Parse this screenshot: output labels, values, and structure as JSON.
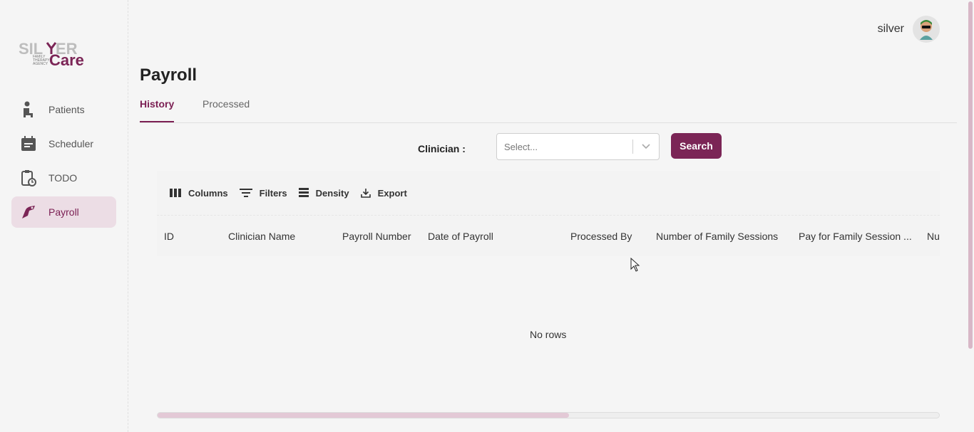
{
  "brand": {
    "logo_top": "SILVER",
    "logo_sub": "FAMILY THERAPY AGENCY",
    "logo_main": "Care"
  },
  "sidebar": {
    "items": [
      {
        "label": "Patients",
        "icon": "patient-icon"
      },
      {
        "label": "Scheduler",
        "icon": "calendar-icon"
      },
      {
        "label": "TODO",
        "icon": "clipboard-clock-icon"
      },
      {
        "label": "Payroll",
        "icon": "payroll-hand-icon",
        "active": true
      }
    ]
  },
  "user": {
    "name": "silver",
    "icon": "avatar-icon"
  },
  "page": {
    "title": "Payroll"
  },
  "tabs": [
    {
      "label": "History",
      "active": true
    },
    {
      "label": "Processed"
    }
  ],
  "filter": {
    "label": "Clinician :",
    "select_placeholder": "Select...",
    "search_label": "Search"
  },
  "toolbar": {
    "columns": "Columns",
    "filters": "Filters",
    "density": "Density",
    "export": "Export"
  },
  "table": {
    "columns": [
      "ID",
      "Clinician Name",
      "Payroll Number",
      "Date of Payroll",
      "Processed By",
      "Number of Family Sessions",
      "Pay for Family Session ...",
      "Nu"
    ],
    "empty_text": "No rows"
  },
  "colors": {
    "accent": "#7b2556",
    "active_bg": "#ecdde5",
    "background": "#f5f5f5"
  }
}
